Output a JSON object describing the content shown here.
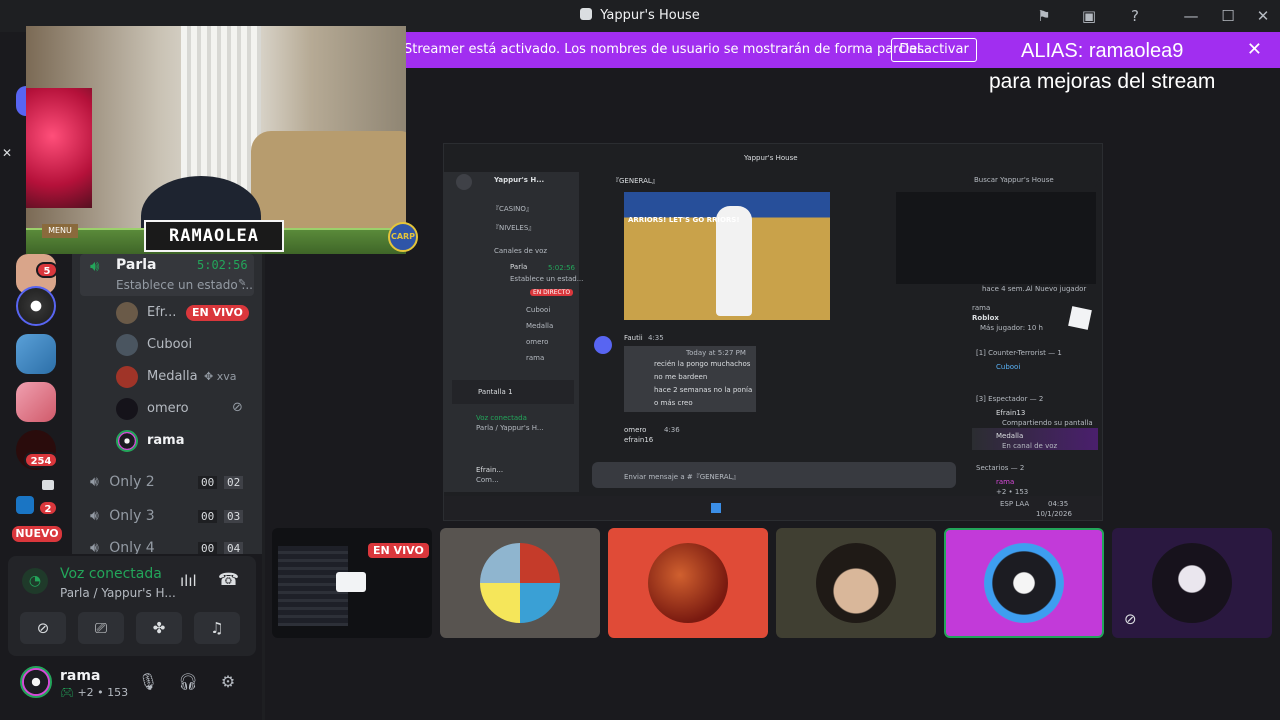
{
  "window": {
    "title": "Yappur's House"
  },
  "streamer_banner": {
    "text": "Streamer está activado. Los nombres de usuario se mostrarán de forma parcial.",
    "button": "Desactivar"
  },
  "overlay": {
    "alias": "ALIAS: ramaolea9",
    "subtitle": "para mejoras del stream",
    "webcam_name": "RAMAOLEA",
    "webcam_menu": "MENU",
    "badge": "CARP"
  },
  "servers": {
    "badge_1": "5",
    "badge_2": "254",
    "badge_3": "2",
    "nuevo": "NUEVO"
  },
  "voice_channel": {
    "name": "Parla",
    "timer": "5:02:56",
    "status": "Establece un estado ...",
    "members": [
      {
        "name": "Efr...",
        "live": "EN VIVO"
      },
      {
        "name": "Cubooi"
      },
      {
        "name": "Medalla",
        "extra": "xva"
      },
      {
        "name": "omero"
      },
      {
        "name": "rama"
      }
    ],
    "others": [
      {
        "name": "Only 2",
        "a": "00",
        "b": "02"
      },
      {
        "name": "Only 3",
        "a": "00",
        "b": "03"
      },
      {
        "name": "Only 4",
        "a": "00",
        "b": "04"
      }
    ]
  },
  "voice_panel": {
    "status": "Voz conectada",
    "location": "Parla / Yappur's H..."
  },
  "user_panel": {
    "name": "rama",
    "status": "+2 • 153"
  },
  "share": {
    "title": "Yappur's House",
    "server": "Yappur's H...",
    "channel": "『GENERAL』",
    "search": "Buscar Yappur's House",
    "ch_casino": "『CASINO』",
    "ch_niveles": "『NIVELES』",
    "voice_header": "Canales de voz",
    "parla": "Parla",
    "parla_time": "5:02:56",
    "parla_status": "Establece un estad...",
    "live": "EN DIRECTO",
    "m1": "Cubooi",
    "m2": "Medalla",
    "m3": "omero",
    "m4": "rama",
    "gif_text": "ARRIORS!  LET'S GO  RRIORS!",
    "msg1_author": "Fautii",
    "msg1_time": "4:35",
    "quote_time": "Today at 5:27 PM",
    "quote_lines": [
      "recién la pongo muchachos",
      "no me bardeen",
      "hace 2 semanas no la ponía",
      "o más creo"
    ],
    "msg2_author": "omero",
    "msg2_time": "4:36",
    "msg2_text": "efrain16",
    "input_placeholder": "Enviar mensaje a #『GENERAL』",
    "panel_title": "Pantalla 1",
    "vc_status": "Voz conectada",
    "vc_loc": "Parla / Yappur's H...",
    "user": "Efrain...",
    "user_sub": "Com...",
    "act_user": "rama",
    "act_game": "Roblox",
    "act_time": "Más jugador: 10 h",
    "ct_header": "[1]  Counter-Terrorist — 1",
    "ct_user": "Cubooi",
    "spec_header": "[3]  Espectador — 2",
    "spec_user1": "Efrain13",
    "spec_user1_sub": "Compartiendo su pantalla",
    "spec_user2": "Medalla",
    "spec_user2_sub": "En canal de voz",
    "sect_header": "Sectarios — 2",
    "sect_user": "rama",
    "sect_sub": "+2 • 153",
    "tray_lang": "ESP LAA",
    "tray_time": "04:35",
    "tray_date": "10/1/2026",
    "stats_left": "hace 4 sem...",
    "stats_right": "Al Nuevo jugador"
  },
  "tiles": {
    "live": "EN VIVO"
  },
  "colors": {
    "accent_purple": "#a12ef0",
    "live_red": "#da373c",
    "voice_green": "#23a55a",
    "tile_orange": "#e04b37",
    "tile_olive": "#403f32",
    "tile_magenta": "#c23ad9"
  }
}
